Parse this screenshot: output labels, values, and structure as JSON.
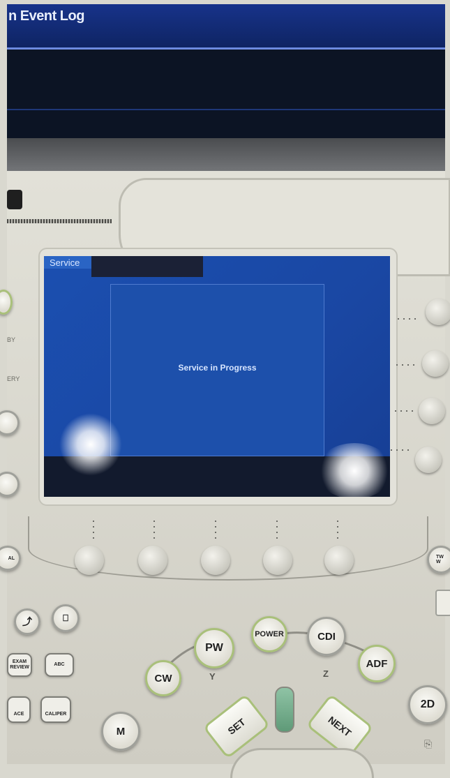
{
  "monitor": {
    "title": "n Event Log"
  },
  "touchscreen": {
    "tab_label": "Service",
    "status_message": "Service in Progress"
  },
  "panel_side_labels": {
    "standby": "BY",
    "battery": "ERY",
    "left_edge": "AL"
  },
  "right_edge_button": "TW\nW",
  "square_buttons": {
    "exam_review": "EXAM\nREVIEW",
    "abc": "ABC",
    "trace": "ACE",
    "caliper": "CALIPER"
  },
  "mode_buttons": {
    "pw": "PW",
    "cw": "CW",
    "power": "POWER",
    "cdi": "CDI",
    "adf": "ADF",
    "m": "M",
    "two_d": "2D"
  },
  "axis_labels": {
    "y": "Y",
    "z": "Z"
  },
  "nav_buttons": {
    "set": "SET",
    "next": "NEXT"
  }
}
